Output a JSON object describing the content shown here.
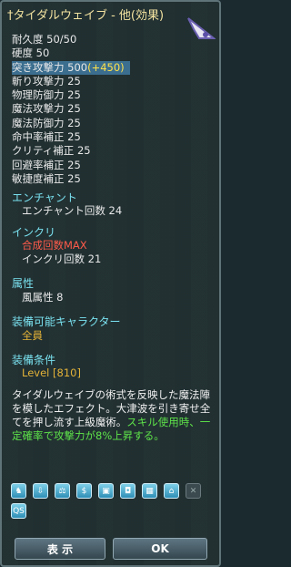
{
  "title": "†タイダルウェイブ - 他(効果)",
  "stats": [
    {
      "label": "耐久度 50/50"
    },
    {
      "label": "硬度 50"
    },
    {
      "label": "突き攻撃力 500",
      "bonus": "(+450)"
    },
    {
      "label": "斬り攻撃力 25"
    },
    {
      "label": "物理防御力 25"
    },
    {
      "label": "魔法攻撃力 25"
    },
    {
      "label": "魔法防御力 25"
    },
    {
      "label": "命中率補正 25"
    },
    {
      "label": "クリティ補正 25"
    },
    {
      "label": "回避率補正 25"
    },
    {
      "label": "敏捷度補正 25"
    }
  ],
  "sections": {
    "enchant": {
      "heading": "エンチャント",
      "value": "エンチャント回数 24"
    },
    "inkuri": {
      "heading": "インクリ",
      "max_label": "合成回数MAX",
      "value": "インクリ回数 21"
    },
    "attribute": {
      "heading": "属性",
      "value": "風属性 8"
    },
    "equip_chars": {
      "heading": "装備可能キャラクター",
      "value": "全員"
    },
    "equip_cond": {
      "heading": "装備条件",
      "value": "Level [810]"
    }
  },
  "description": {
    "text": "タイダルウェイブの術式を反映した魔法陣を模したエフェクト。大津波を引き寄せ全てを押し流す上級魔術。",
    "green_text": "スキル使用時、一定確率で攻撃力が8%上昇する。"
  },
  "icons": [
    "QS"
  ],
  "buttons": {
    "show": "表 示",
    "ok": "OK"
  },
  "colors": {
    "heading": "#79e0ee",
    "bonus": "#ffe14a",
    "red": "#ff5a4a",
    "gold": "#e3b238",
    "green": "#5ee34a"
  }
}
